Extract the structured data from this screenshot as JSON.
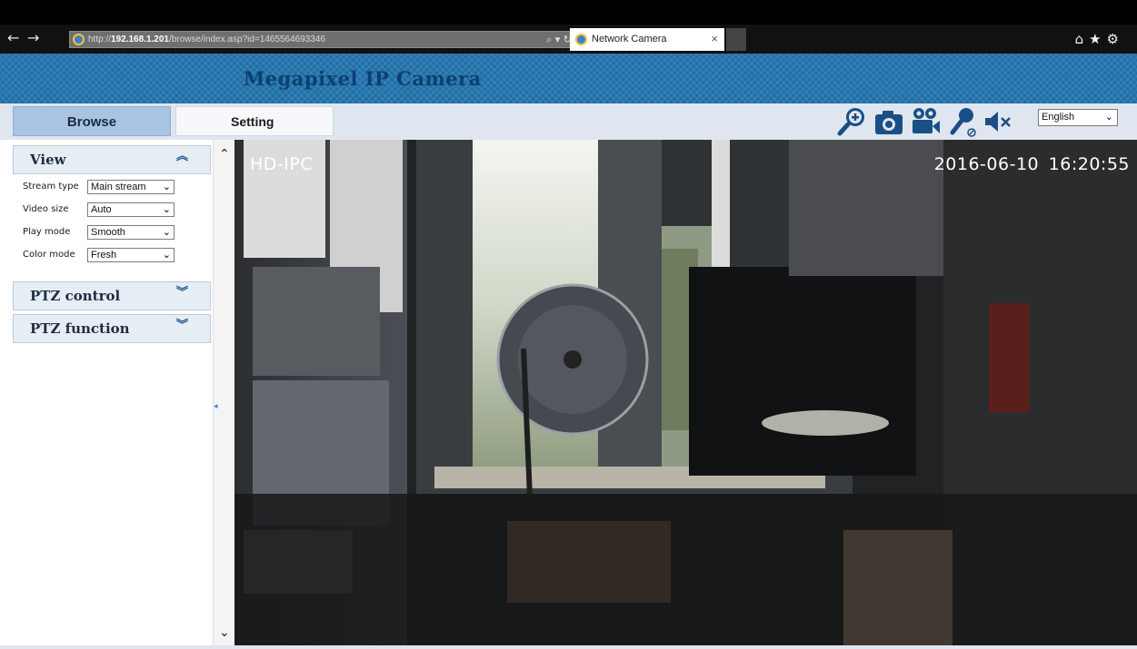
{
  "browser": {
    "back_icon": "back-arrow-icon",
    "forward_icon": "forward-arrow-icon",
    "url_prefix": "http://",
    "url_host": "192.168.1.201",
    "url_path": "/browse/index.asp?id=1465564693346",
    "addr_tools": "⌕ ▾ ↻",
    "tab_title": "Network Camera",
    "tab_close": "×",
    "right_icons": [
      "home-icon",
      "star-icon",
      "gear-icon"
    ]
  },
  "banner": {
    "title": "Megapixel IP Camera"
  },
  "tabs": {
    "browse": "Browse",
    "setting": "Setting"
  },
  "toolbar": {
    "icons": [
      "zoom-in-icon",
      "snapshot-camera-icon",
      "record-video-icon",
      "microphone-icon",
      "mute-speaker-icon"
    ],
    "language": "English"
  },
  "panel": {
    "view": {
      "title": "View",
      "fields": [
        {
          "label": "Stream type",
          "value": "Main stream"
        },
        {
          "label": "Video size",
          "value": "Auto"
        },
        {
          "label": "Play mode",
          "value": "Smooth"
        },
        {
          "label": "Color mode",
          "value": "Fresh"
        }
      ]
    },
    "ptz_control": {
      "title": "PTZ control"
    },
    "ptz_function": {
      "title": "PTZ function"
    }
  },
  "video": {
    "osd_name": "HD-IPC",
    "osd_timestamp": "2016-06-10 16:20:55"
  }
}
